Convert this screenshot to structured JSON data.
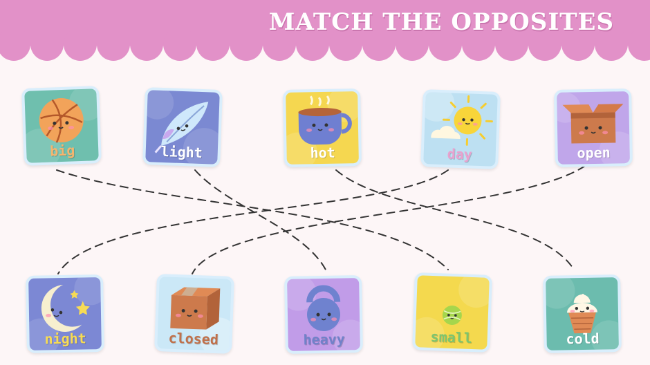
{
  "title": "MATCH THE OPPOSITES",
  "colors": {
    "header": "#e291c8",
    "background": "#fdf6f7",
    "card_border": "#d9eefc",
    "dash_line": "#333333"
  },
  "top_cards": [
    {
      "label": "big",
      "icon": "basketball-icon"
    },
    {
      "label": "light",
      "icon": "feather-icon"
    },
    {
      "label": "hot",
      "icon": "hot-cup-icon"
    },
    {
      "label": "day",
      "icon": "sun-cloud-icon"
    },
    {
      "label": "open",
      "icon": "open-box-icon"
    }
  ],
  "bottom_cards": [
    {
      "label": "night",
      "icon": "moon-stars-icon"
    },
    {
      "label": "closed",
      "icon": "closed-box-icon"
    },
    {
      "label": "heavy",
      "icon": "kettlebell-icon"
    },
    {
      "label": "small",
      "icon": "tennis-ball-icon"
    },
    {
      "label": "cold",
      "icon": "ice-cream-icon"
    }
  ],
  "matches": [
    {
      "from": "big",
      "to": "small"
    },
    {
      "from": "light",
      "to": "heavy"
    },
    {
      "from": "hot",
      "to": "cold"
    },
    {
      "from": "day",
      "to": "night"
    },
    {
      "from": "open",
      "to": "closed"
    }
  ]
}
